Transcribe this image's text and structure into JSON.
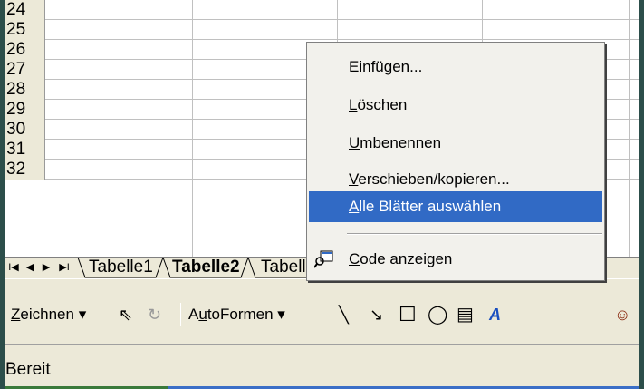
{
  "rows": [
    "24",
    "25",
    "26",
    "27",
    "28",
    "29",
    "30",
    "31",
    "32"
  ],
  "sheet_nav": {
    "first": "I◀",
    "prev": "◀",
    "next": "▶",
    "last": "▶I"
  },
  "sheet_tabs": [
    {
      "label": "Tabelle1",
      "active": false
    },
    {
      "label": "Tabelle2",
      "active": true
    },
    {
      "label": "Tabelle3",
      "active": false
    }
  ],
  "context_menu": {
    "items": [
      {
        "pre": "",
        "u": "E",
        "post": "infügen..."
      },
      {
        "pre": "",
        "u": "L",
        "post": "öschen"
      },
      {
        "pre": "",
        "u": "U",
        "post": "mbenennen"
      },
      {
        "pre": "",
        "u": "V",
        "post": "erschieben/kopieren..."
      },
      {
        "pre": "",
        "u": "A",
        "post": "lle Blätter auswählen"
      },
      {
        "pre": "",
        "u": "C",
        "post": "ode anzeigen"
      }
    ],
    "highlighted_index": 4
  },
  "drawing_toolbar": {
    "draw_pre": "",
    "draw_u": "Z",
    "draw_post": "eichnen",
    "autoshapes_pre": "A",
    "autoshapes_u": "u",
    "autoshapes_post": "toFormen",
    "dropdown_arrow": "▾",
    "select_glyph": "⇖",
    "rotate_glyph": "↻",
    "line_glyph": "╲",
    "arrow_glyph": "↘",
    "rect_glyph": "☐",
    "oval_glyph": "◯",
    "textbox_glyph": "▤",
    "wordart_glyph": "A",
    "clipart_glyph": "☺"
  },
  "status": {
    "text": "Bereit"
  },
  "colors": {
    "menu_highlight": "#316ac5",
    "window_chrome": "#ece9d8"
  }
}
